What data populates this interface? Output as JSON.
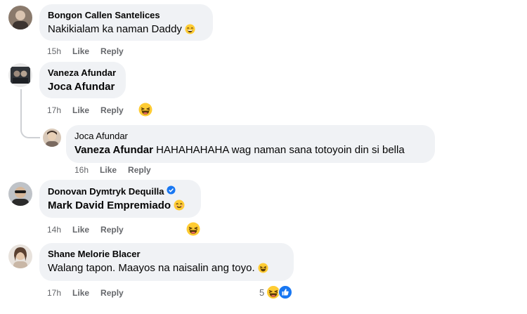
{
  "comments": [
    {
      "author": "Bongon Callen Santelices",
      "text": "Nakikialam ka naman Daddy",
      "time": "15h",
      "like": "Like",
      "reply": "Reply"
    },
    {
      "author": "Vaneza Afundar",
      "mention": "Joca Afundar",
      "time": "17h",
      "like": "Like",
      "reply": "Reply",
      "reaction_icon": "laughing-reaction-icon"
    },
    {
      "author": "Joca Afundar",
      "mention": "Vaneza Afundar",
      "text": "HAHAHAHAHA wag naman sana totoyoin din si bella",
      "time": "16h",
      "like": "Like",
      "reply": "Reply"
    },
    {
      "author": "Donovan Dymtryk Dequilla",
      "verified": true,
      "mention": "Mark David Empremiado",
      "time": "14h",
      "like": "Like",
      "reply": "Reply",
      "reaction_icon": "laughing-reaction-icon"
    },
    {
      "author": "Shane Melorie Blacer",
      "text": "Walang tapon. Maayos na naisalin ang toyo.",
      "time": "17h",
      "like": "Like",
      "reply": "Reply",
      "reaction_count": "5",
      "reaction_icons": [
        "laughing-reaction-icon",
        "like-reaction-icon"
      ]
    }
  ],
  "colors": {
    "bubble": "#f0f2f5",
    "meta": "#65676b",
    "verified": "#1877f2",
    "emoji_yellow": "#ffcc33"
  }
}
